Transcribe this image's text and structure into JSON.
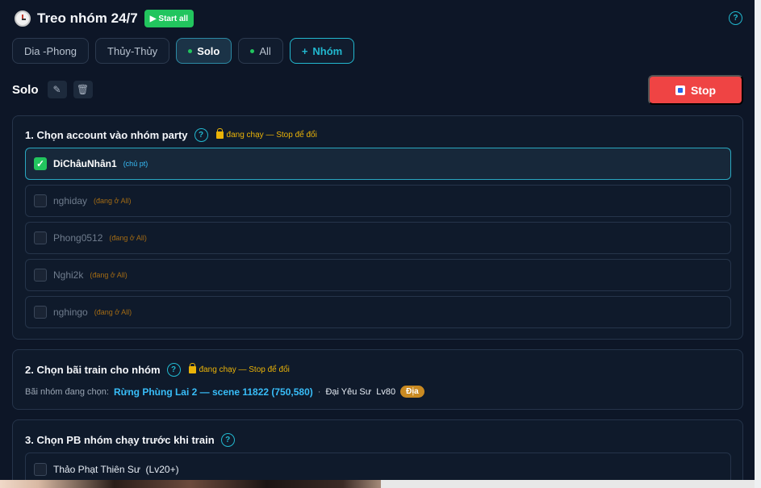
{
  "header": {
    "title": "Treo nhóm 24/7",
    "start_all_label": "Start all",
    "start_all_icon": "play-icon"
  },
  "tabs": [
    {
      "label": "Dia -Phong",
      "active": false,
      "running": false
    },
    {
      "label": "Thủy-Thủy",
      "active": false,
      "running": false
    },
    {
      "label": "Solo",
      "active": true,
      "running": true
    },
    {
      "label": "All",
      "active": false,
      "running": true
    }
  ],
  "add_group": {
    "icon": "+",
    "label": "Nhóm"
  },
  "group": {
    "name": "Solo",
    "edit_icon": "pencil-icon",
    "delete_icon": "trash-icon",
    "stop_label": "Stop"
  },
  "section1": {
    "title": "1. Chọn account vào nhóm party",
    "help": "?",
    "lock_note": "đang chạy — Stop để đổi",
    "accounts": [
      {
        "name": "DiChâuNhân1",
        "tag": "(chủ pt)",
        "checked": true
      },
      {
        "name": "nghiday",
        "tag": "(đang ở All)",
        "checked": false
      },
      {
        "name": "Phong0512",
        "tag": "(đang ở All)",
        "checked": false
      },
      {
        "name": "Nghi2k",
        "tag": "(đang ở All)",
        "checked": false
      },
      {
        "name": "nghingo",
        "tag": "(đang ở All)",
        "checked": false
      }
    ]
  },
  "section2": {
    "title": "2. Chọn bãi train cho nhóm",
    "help": "?",
    "lock_note": "đang chạy — Stop để đổi",
    "selected_label": "Bãi nhóm đang chọn:",
    "selected_value": "Rừng Phùng Lai 2 — scene 11822 (750,580)",
    "separator": "·",
    "extra": "Đại Yêu Sư  Lv80",
    "badge": "Địa"
  },
  "section3": {
    "title": "3. Chọn PB nhóm chạy trước khi train",
    "help": "?",
    "items": [
      {
        "name": "Thảo Phạt Thiên Sư  (Lv20+)",
        "checked": false
      }
    ]
  },
  "colors": {
    "background": "#0d1627",
    "accent": "#22b8cf",
    "start": "#22c55e",
    "stop": "#ef4444",
    "warning": "#eab308",
    "badge": "#c98a22"
  }
}
